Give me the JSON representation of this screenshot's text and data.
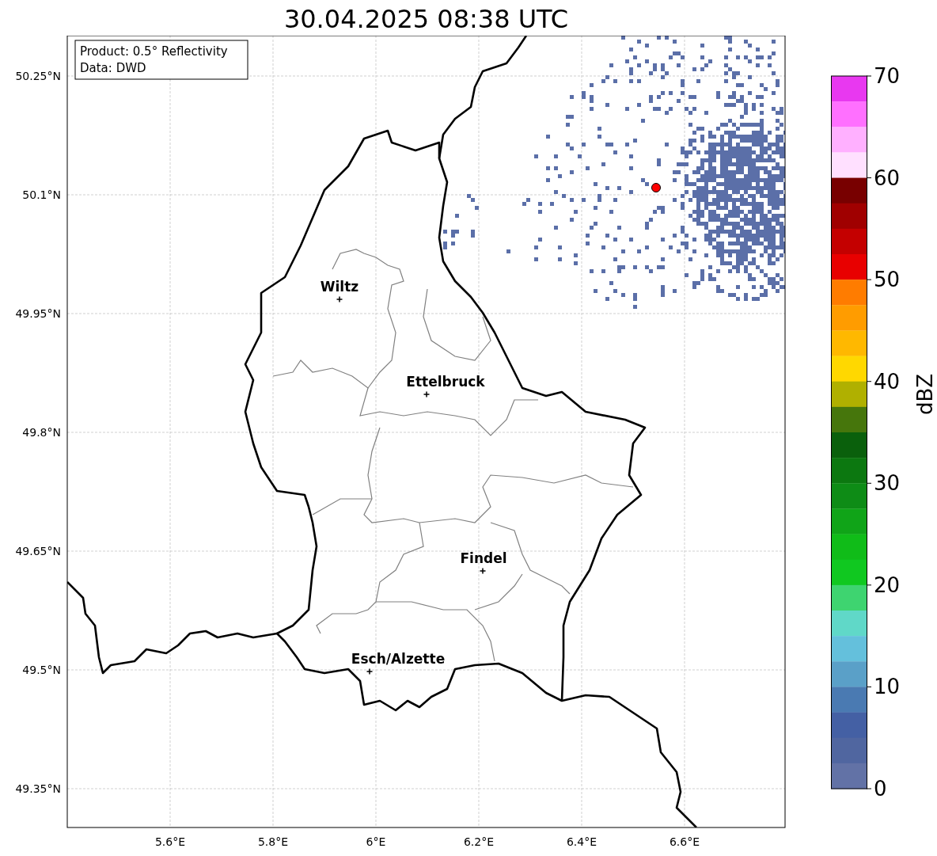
{
  "title": "30.04.2025 08:38 UTC",
  "info_box": {
    "lines": [
      "Product: 0.5° Reflectivity",
      "Data: DWD"
    ]
  },
  "map": {
    "lat_labels": [
      "50.25°N",
      "50.1°N",
      "49.95°N",
      "49.8°N",
      "49.65°N",
      "49.5°N",
      "49.35°N"
    ],
    "lon_labels": [
      "5.6°E",
      "5.8°E",
      "6°E",
      "6.2°E",
      "6.4°E",
      "6.6°E"
    ],
    "cities": [
      "Wiltz",
      "Ettelbruck",
      "Findel",
      "Esch/Alzette"
    ]
  },
  "colorbar": {
    "label": "dBZ",
    "ticks": [
      "70",
      "60",
      "50",
      "40",
      "30",
      "20",
      "10",
      "0"
    ],
    "segments": [
      {
        "color": "#e838f0"
      },
      {
        "color": "#ff70ff"
      },
      {
        "color": "#ffb0ff"
      },
      {
        "color": "#ffe0ff"
      },
      {
        "color": "#780000"
      },
      {
        "color": "#a00000"
      },
      {
        "color": "#c40000"
      },
      {
        "color": "#e80000"
      },
      {
        "color": "#ff7c00"
      },
      {
        "color": "#ff9c00"
      },
      {
        "color": "#ffb800"
      },
      {
        "color": "#ffd800"
      },
      {
        "color": "#b0b000"
      },
      {
        "color": "#46760c"
      },
      {
        "color": "#0a600c"
      },
      {
        "color": "#0c7810"
      },
      {
        "color": "#0e8c16"
      },
      {
        "color": "#10a418"
      },
      {
        "color": "#10bc18"
      },
      {
        "color": "#10c820"
      },
      {
        "color": "#3ed470"
      },
      {
        "color": "#60d8c8"
      },
      {
        "color": "#64c0dc"
      },
      {
        "color": "#5aa0c8"
      },
      {
        "color": "#4a7ab2"
      },
      {
        "color": "#4460a4"
      },
      {
        "color": "#5066a0"
      },
      {
        "color": "#6272a6"
      }
    ]
  }
}
